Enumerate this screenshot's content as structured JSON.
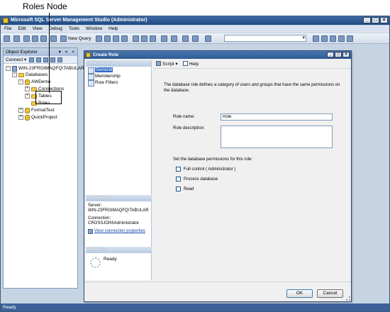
{
  "callout": {
    "label": "Roles Node"
  },
  "app": {
    "title": "Microsoft SQL Server Management Studio (Administrator)",
    "menu": [
      "File",
      "Edit",
      "View",
      "Debug",
      "Tools",
      "Window",
      "Help"
    ],
    "toolbar": {
      "new_query": "New Query"
    },
    "status": "Ready"
  },
  "object_explorer": {
    "title": "Object Explorer",
    "header_buttons": "▾ ⌖ ×",
    "connect": "Connect ▾",
    "tree": {
      "server": "WIN-23FRGIMAQFQ\\TABULAR",
      "databases": "Databases",
      "aw": "AWDemo",
      "connections": "Connections",
      "tables": "Tables",
      "roles": "Roles",
      "format_test": "FormatTest",
      "quick_project": "QuickProject"
    }
  },
  "dialog": {
    "title": "Create Role",
    "select_page": "Select a page",
    "pages": [
      "General",
      "Membership",
      "Row Filters"
    ],
    "script": "Script ▾",
    "help": "Help",
    "description": "The database role defines a category of users and groups that have the same permissions on the database.",
    "role_name_label": "Role name:",
    "role_name_value": "Role",
    "role_desc_label": "Role description:",
    "perm_label": "Set the database permissions for this role:",
    "perms": [
      "Full control ( Administrator )",
      "Process database",
      "Read"
    ],
    "connection": {
      "header": "Connection",
      "server_label": "Server:",
      "server": "WIN-23FRGIMAQFQ\\TABULAR",
      "conn_label": "Connection:",
      "conn": "CROSSJOIN\\Administrator",
      "view_link": "View connection properties"
    },
    "progress": {
      "header": "Progress",
      "status": "Ready"
    },
    "ok": "OK",
    "cancel": "Cancel"
  },
  "colors": {
    "title_bar": "#2d5a92",
    "status_bar": "#3d6299",
    "selection": "#316ac5"
  }
}
